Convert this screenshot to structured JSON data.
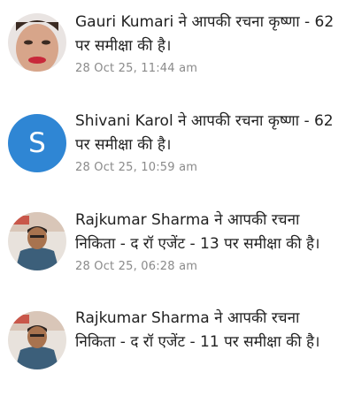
{
  "notifications": [
    {
      "avatar": "photo",
      "user": "Gauri Kumari",
      "line1_rest": " ने आपकी रचना कृष्णा - 62",
      "line2": "पर समीक्षा की है।",
      "time": "28 Oct 25, 11:44 am"
    },
    {
      "avatar": "letter",
      "avatar_letter": "S",
      "avatar_color": "#2f86d4",
      "user": "Shivani Karol",
      "line1_rest": " ने आपकी रचना कृष्णा - 62",
      "line2": "पर समीक्षा की है।",
      "time": "28 Oct 25, 10:59 am"
    },
    {
      "avatar": "photo",
      "user": "Rajkumar Sharma",
      "line1_rest": " ने आपकी रचना",
      "line2": "निकिता - द रॉ एजेंट - 13 पर समीक्षा की है।",
      "time": "28 Oct 25, 06:28 am"
    },
    {
      "avatar": "photo",
      "user": "Rajkumar Sharma",
      "line1_rest": " ने आपकी रचना",
      "line2": "निकिता - द रॉ एजेंट - 11 पर समीक्षा की है।",
      "time": ""
    }
  ]
}
